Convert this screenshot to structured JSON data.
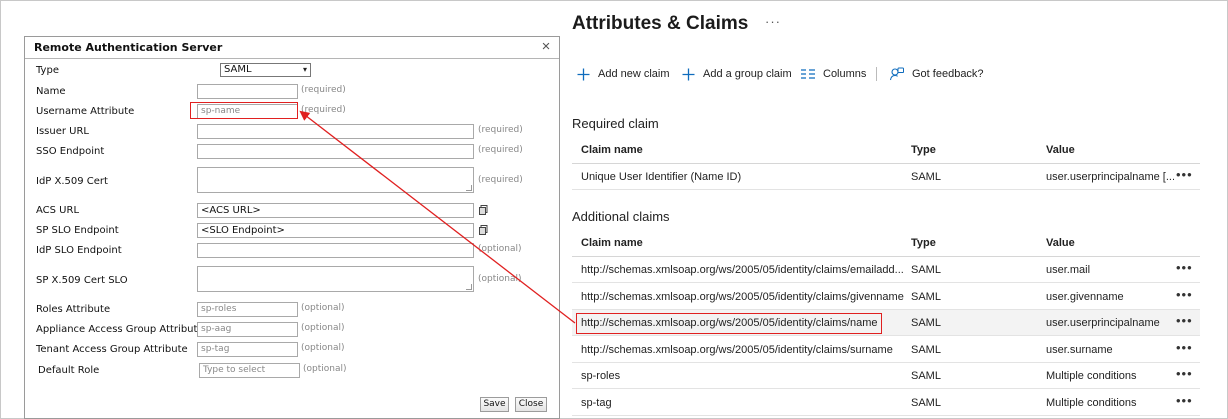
{
  "dialog": {
    "title": "Remote Authentication Server",
    "close_glyph": "×",
    "fields": {
      "type": {
        "label": "Type",
        "value": "SAML"
      },
      "name": {
        "label": "Name",
        "hint": "(required)"
      },
      "username_attribute": {
        "label": "Username Attribute",
        "value": "sp-name",
        "hint": "(required)"
      },
      "issuer_url": {
        "label": "Issuer URL",
        "hint": "(required)"
      },
      "sso_endpoint": {
        "label": "SSO Endpoint",
        "hint": "(required)"
      },
      "idp_cert": {
        "label": "IdP X.509 Cert",
        "hint": "(required)"
      },
      "acs_url": {
        "label": "ACS URL",
        "value": "<ACS URL>"
      },
      "sp_slo_endpoint": {
        "label": "SP SLO Endpoint",
        "value": "<SLO Endpoint>"
      },
      "idp_slo_endpoint": {
        "label": "IdP SLO Endpoint",
        "hint": "(optional)"
      },
      "sp_cert_slo": {
        "label": "SP X.509 Cert SLO",
        "hint": "(optional)"
      },
      "roles_attribute": {
        "label": "Roles Attribute",
        "value": "sp-roles",
        "hint": "(optional)"
      },
      "appliance_access": {
        "label": "Appliance Access Group Attribute",
        "value": "sp-aag",
        "hint": "(optional)"
      },
      "tenant_access": {
        "label": "Tenant Access Group Attribute",
        "value": "sp-tag",
        "hint": "(optional)"
      },
      "default_role": {
        "label": "Default Role",
        "placeholder": "Type to select",
        "hint": "(optional)"
      }
    },
    "buttons": {
      "save": "Save",
      "close": "Close"
    }
  },
  "claims": {
    "title": "Attributes & Claims",
    "title_more": "···",
    "toolbar": {
      "add_new_claim": "Add new claim",
      "add_group_claim": "Add a group claim",
      "columns": "Columns",
      "feedback": "Got feedback?"
    },
    "columns": {
      "name": "Claim name",
      "type": "Type",
      "value": "Value"
    },
    "required": {
      "heading": "Required claim",
      "rows": [
        {
          "name": "Unique User Identifier (Name ID)",
          "type": "SAML",
          "value": "user.userprincipalname [..."
        }
      ]
    },
    "additional": {
      "heading": "Additional claims",
      "rows": [
        {
          "name": "http://schemas.xmlsoap.org/ws/2005/05/identity/claims/emailadd...",
          "type": "SAML",
          "value": "user.mail"
        },
        {
          "name": "http://schemas.xmlsoap.org/ws/2005/05/identity/claims/givenname",
          "type": "SAML",
          "value": "user.givenname"
        },
        {
          "name": "http://schemas.xmlsoap.org/ws/2005/05/identity/claims/name",
          "type": "SAML",
          "value": "user.userprincipalname"
        },
        {
          "name": "http://schemas.xmlsoap.org/ws/2005/05/identity/claims/surname",
          "type": "SAML",
          "value": "user.surname"
        },
        {
          "name": "sp-roles",
          "type": "SAML",
          "value": "Multiple conditions"
        },
        {
          "name": "sp-tag",
          "type": "SAML",
          "value": "Multiple conditions"
        }
      ]
    },
    "more_glyph": "•••"
  },
  "colors": {
    "accent": "#0f6cbd",
    "highlight": "#e02020"
  }
}
